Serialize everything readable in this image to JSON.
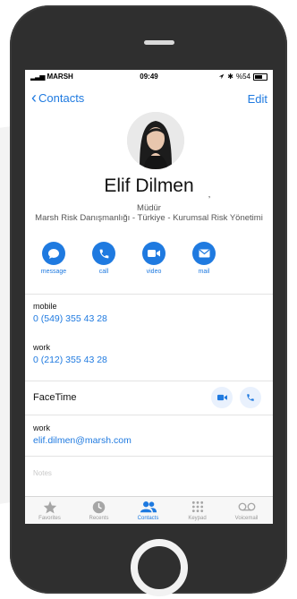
{
  "status_bar": {
    "carrier": "MARSH",
    "time": "09:49",
    "battery": "%54",
    "battery_level": 0.54
  },
  "nav": {
    "back_label": "Contacts",
    "edit_label": "Edit"
  },
  "contact": {
    "name": "Elif Dilmen",
    "stray_mark": "‚",
    "title": "Müdür",
    "organization": "Marsh Risk Danışmanlığı - Türkiye - Kurumsal Risk Yönetimi"
  },
  "actions": [
    {
      "label": "message",
      "icon": "message-bubble-icon"
    },
    {
      "label": "call",
      "icon": "phone-icon"
    },
    {
      "label": "video",
      "icon": "video-camera-icon"
    },
    {
      "label": "mail",
      "icon": "envelope-icon"
    }
  ],
  "fields": {
    "mobile": {
      "label": "mobile",
      "value": "0 (549) 355 43 28"
    },
    "work_phone": {
      "label": "work",
      "value": "0 (212) 355 43 28"
    },
    "facetime": {
      "label": "FaceTime"
    },
    "work_email": {
      "label": "work",
      "value": "elif.dilmen@marsh.com"
    },
    "notes": {
      "placeholder": "Notes"
    }
  },
  "tabbar": [
    {
      "label": "Favorites",
      "icon": "star-icon",
      "active": false
    },
    {
      "label": "Recents",
      "icon": "clock-icon",
      "active": false
    },
    {
      "label": "Contacts",
      "icon": "contacts-icon",
      "active": true
    },
    {
      "label": "Keypad",
      "icon": "keypad-icon",
      "active": false
    },
    {
      "label": "Voicemail",
      "icon": "voicemail-icon",
      "active": false
    }
  ],
  "colors": {
    "accent": "#1f7ae0",
    "phone_body": "#2f2f2f",
    "label_gray": "#9a9a9a"
  }
}
